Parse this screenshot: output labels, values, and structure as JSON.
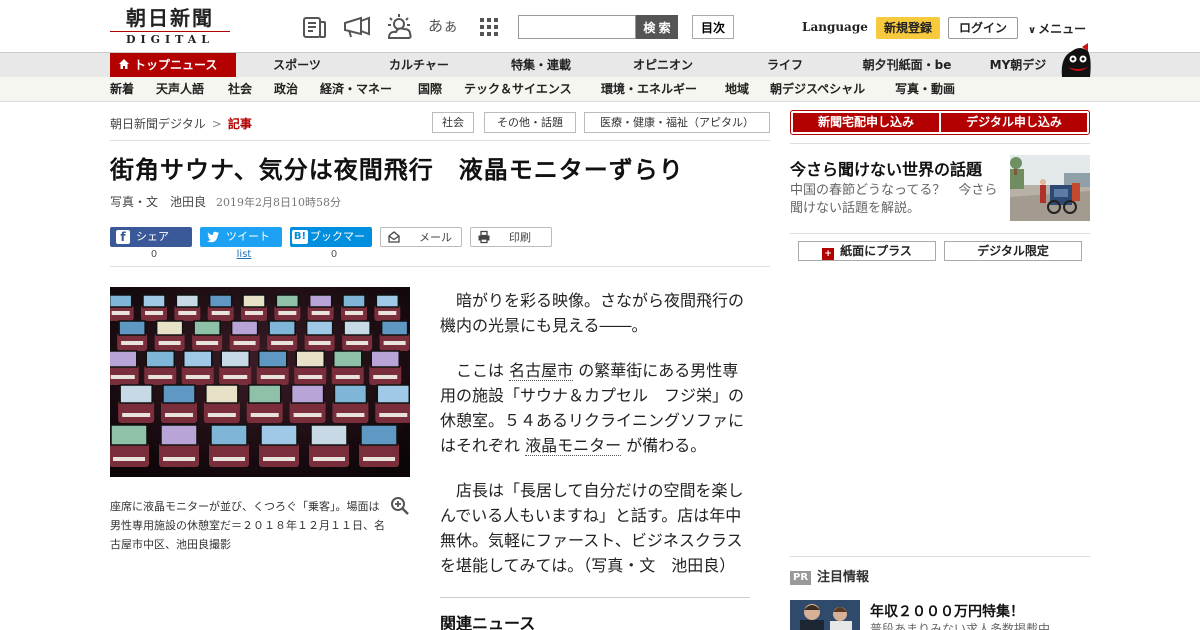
{
  "header": {
    "logo_ja": "朝日新聞",
    "logo_en": "DIGITAL",
    "icons": [
      "newspaper-icon",
      "megaphone-icon",
      "weather-icon",
      "text-size-icon",
      "apps-grid-icon"
    ],
    "text_size_glyph": "あぁ",
    "search_placeholder": "",
    "search_label": "検 索",
    "index_label": "目次",
    "language_label": "Language",
    "register_label": "新規登録",
    "login_label": "ログイン",
    "menu_label": "メニュー"
  },
  "nav_main": [
    "トップニュース",
    "スポーツ",
    "カルチャー",
    "特集・連載",
    "オピニオン",
    "ライフ",
    "朝夕刊紙面・be",
    "MY朝デジ"
  ],
  "nav_sub": [
    "新着",
    "天声人語",
    "社会",
    "政治",
    "経済・マネー",
    "国際",
    "テック＆サイエンス",
    "環境・エネルギー",
    "地域",
    "朝デジスペシャル",
    "写真・動画"
  ],
  "breadcrumb": {
    "home": "朝日新聞デジタル",
    "separator": ">",
    "current": "記事",
    "tags": [
      "社会",
      "その他・話題",
      "医療・健康・福祉（アピタル）"
    ]
  },
  "article": {
    "title": "街角サウナ、気分は夜間飛行　液晶モニターずらり",
    "byline": "写真・文　池田良",
    "date": "2019年2月8日10時58分",
    "share": {
      "facebook_label": "シェア",
      "facebook_count": "0",
      "twitter_label": "ツイート",
      "twitter_count": "list",
      "hatena_label": "ブックマーク",
      "hatena_count": "0",
      "mail_label": "メール",
      "print_label": "印刷"
    },
    "caption": "座席に液晶モニターが並び、くつろぐ「乗客」。場面は男性専用施設の休憩室だ＝２０１８年１２月１１日、名古屋市中区、池田良撮影",
    "p1": "暗がりを彩る映像。さながら夜間飛行の機内の光景にも見える――。",
    "p2_a": "ここは",
    "p2_link1": "名古屋市",
    "p2_b": "の繁華街にある男性専用の施設「サウナ＆カプセル　フジ栄」の休憩室。５４あるリクライニングソファにはそれぞれ",
    "p2_link2": "液晶モニター",
    "p2_c": "が備わる。",
    "p3": "店長は「長居して自分だけの空間を楽しんでいる人もいますね」と話す。店は年中無休。気軽にファースト、ビジネスクラスを堪能してみては。（写真・文　池田良）",
    "related_heading": "関連ニュース"
  },
  "sidebar": {
    "delivery_label": "新聞宅配申し込み",
    "digital_label": "デジタル申し込み",
    "promo_title": "今さら聞けない世界の話題",
    "promo_text": "中国の春節どうなってる？　今さら聞けない話題を解説。",
    "paper_plus_label": "紙面にプラス",
    "digital_only_label": "デジタル限定",
    "pr_badge": "PR",
    "pr_heading": "注目情報",
    "pr_title": "年収２０００万円特集！",
    "pr_sub": "普段あまりみない求人多数掲載中"
  },
  "colors": {
    "brand_red": "#b30000",
    "register_yellow": "#f7c93d",
    "facebook": "#3b5998",
    "twitter": "#1da1f2",
    "hatena": "#008fde"
  }
}
